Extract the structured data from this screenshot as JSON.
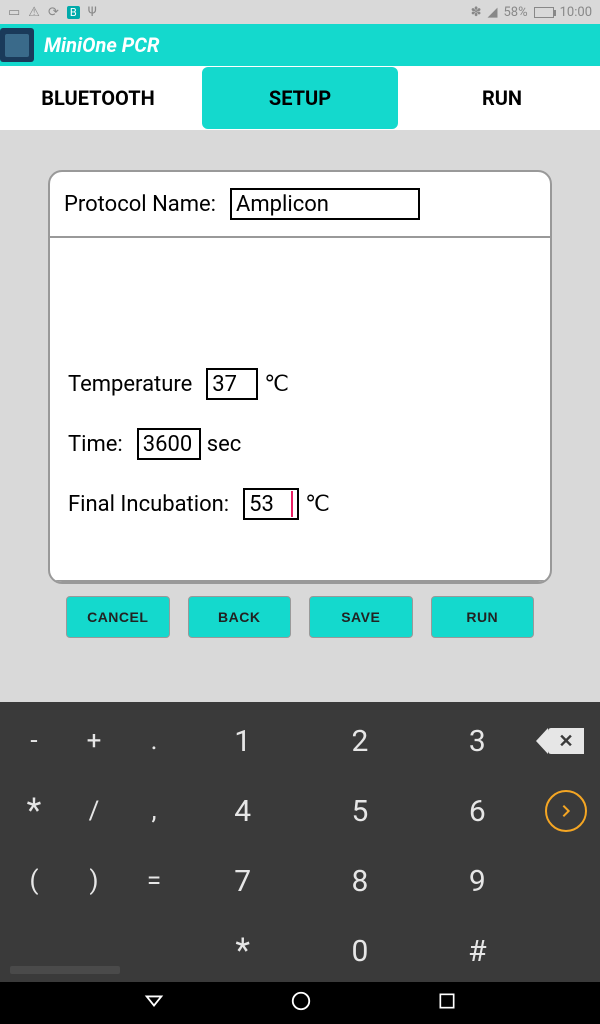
{
  "status": {
    "battery": "58%",
    "time": "10:00"
  },
  "app": {
    "title": "MiniOne PCR"
  },
  "tabs": {
    "bluetooth": "BLUETOOTH",
    "setup": "SETUP",
    "run": "RUN",
    "active": "setup"
  },
  "protocol": {
    "name_label": "Protocol Name:",
    "name_value": "Amplicon",
    "temp_label": "Temperature",
    "temp_value": "37",
    "temp_unit": "℃",
    "time_label": "Time:",
    "time_value": "3600",
    "time_unit": "sec",
    "final_label": "Final Incubation:",
    "final_value": "53",
    "final_unit": "℃"
  },
  "buttons": {
    "cancel": "CANCEL",
    "back": "BACK",
    "save": "SAVE",
    "run": "RUN"
  },
  "keyboard": {
    "r1_syms": [
      "-",
      "+",
      "."
    ],
    "r1_nums": [
      "1",
      "2",
      "3"
    ],
    "r2_syms": [
      "*",
      "/",
      ","
    ],
    "r2_nums": [
      "4",
      "5",
      "6"
    ],
    "r3_syms": [
      "(",
      ")",
      "="
    ],
    "r3_nums": [
      "7",
      "8",
      "9"
    ],
    "r4_nums": [
      "*",
      "0",
      "#"
    ]
  }
}
